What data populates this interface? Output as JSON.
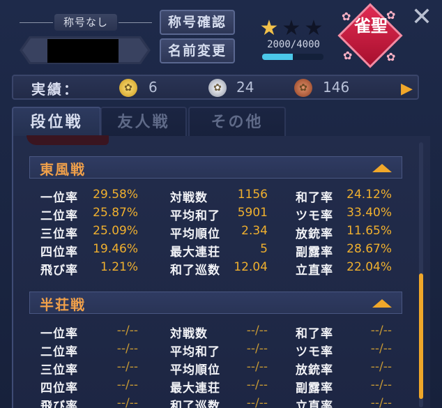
{
  "header": {
    "title_label": "称号なし",
    "btn_title_check": "称号確認",
    "btn_name_change": "名前変更",
    "exp": "2000/4000",
    "exp_fraction": 0.5,
    "stars_filled": 1,
    "stars_total": 3,
    "rank_badge": "雀聖"
  },
  "achievements": {
    "label": "実績：",
    "gold": "6",
    "silver": "24",
    "bronze": "146"
  },
  "tabs": [
    "段位戦",
    "友人戦",
    "その他"
  ],
  "east": {
    "title": "東風戦",
    "rows": [
      {
        "l1": "一位率",
        "v1": "29.58%",
        "l2": "対戦数",
        "v2": "1156",
        "l3": "和了率",
        "v3": "24.12%"
      },
      {
        "l1": "二位率",
        "v1": "25.87%",
        "l2": "平均和了",
        "v2": "5901",
        "l3": "ツモ率",
        "v3": "33.40%"
      },
      {
        "l1": "三位率",
        "v1": "25.09%",
        "l2": "平均順位",
        "v2": "2.34",
        "l3": "放銃率",
        "v3": "11.65%"
      },
      {
        "l1": "四位率",
        "v1": "19.46%",
        "l2": "最大連荘",
        "v2": "5",
        "l3": "副露率",
        "v3": "28.67%"
      },
      {
        "l1": "飛び率",
        "v1": "1.21%",
        "l2": "和了巡数",
        "v2": "12.04",
        "l3": "立直率",
        "v3": "22.04%"
      }
    ]
  },
  "south": {
    "title": "半荘戦",
    "rows": [
      {
        "l1": "一位率",
        "v1": "--/--",
        "l2": "対戦数",
        "v2": "--/--",
        "l3": "和了率",
        "v3": "--/--"
      },
      {
        "l1": "二位率",
        "v1": "--/--",
        "l2": "平均和了",
        "v2": "--/--",
        "l3": "ツモ率",
        "v3": "--/--"
      },
      {
        "l1": "三位率",
        "v1": "--/--",
        "l2": "平均順位",
        "v2": "--/--",
        "l3": "放銃率",
        "v3": "--/--"
      },
      {
        "l1": "四位率",
        "v1": "--/--",
        "l2": "最大連荘",
        "v2": "--/--",
        "l3": "副露率",
        "v3": "--/--"
      },
      {
        "l1": "飛び率",
        "v1": "--/--",
        "l2": "和了巡数",
        "v2": "--/--",
        "l3": "立直率",
        "v3": "--/--"
      }
    ]
  },
  "icons": {
    "close": "close-icon",
    "arrow": "chevron-right-icon",
    "caret": "chevron-up-icon"
  },
  "colors": {
    "accent": "#f0a72a",
    "value": "#f0b02e",
    "exp_bar": "#4bc7e8",
    "rank": "#d41f45"
  }
}
